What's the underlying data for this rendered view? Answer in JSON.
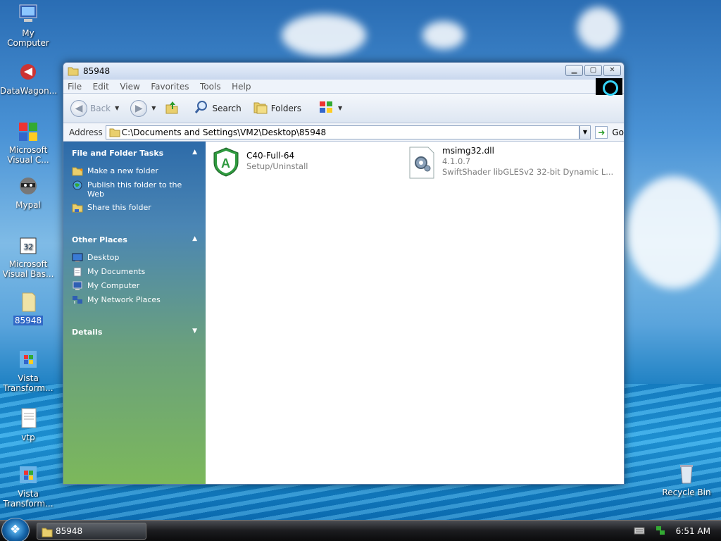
{
  "desktop": {
    "icons": [
      {
        "label": "My Computer"
      },
      {
        "label": "DataWagon..."
      },
      {
        "label": "Microsoft Visual C..."
      },
      {
        "label": "Mypal"
      },
      {
        "label": "Microsoft Visual Bas..."
      },
      {
        "label": "85948"
      },
      {
        "label": "Vista Transform..."
      },
      {
        "label": "vtp"
      },
      {
        "label": "Vista Transform..."
      },
      {
        "label": "Recycle Bin"
      }
    ]
  },
  "window": {
    "title": "85948",
    "menu": [
      "File",
      "Edit",
      "View",
      "Favorites",
      "Tools",
      "Help"
    ],
    "toolbar": {
      "back": "Back",
      "search": "Search",
      "folders": "Folders"
    },
    "address": {
      "label": "Address",
      "value": "C:\\Documents and Settings\\VM2\\Desktop\\85948",
      "go": "Go"
    },
    "tasks": {
      "file_folder": {
        "title": "File and Folder Tasks",
        "items": [
          "Make a new folder",
          "Publish this folder to the Web",
          "Share this folder"
        ]
      },
      "other_places": {
        "title": "Other Places",
        "items": [
          "Desktop",
          "My Documents",
          "My Computer",
          "My Network Places"
        ]
      },
      "details": {
        "title": "Details"
      }
    },
    "files": [
      {
        "name": "C40-Full-64",
        "line2": "Setup/Uninstall",
        "line3": ""
      },
      {
        "name": "msimg32.dll",
        "line2": "4.1.0.7",
        "line3": "SwiftShader libGLESv2 32-bit Dynamic L..."
      }
    ]
  },
  "taskbar": {
    "window_button": "85948",
    "clock": "6:51 AM"
  },
  "colors": {
    "accent": "#3169c6",
    "task_panel_top": "#2d6ba9",
    "task_panel_bottom": "#7cb85b"
  }
}
